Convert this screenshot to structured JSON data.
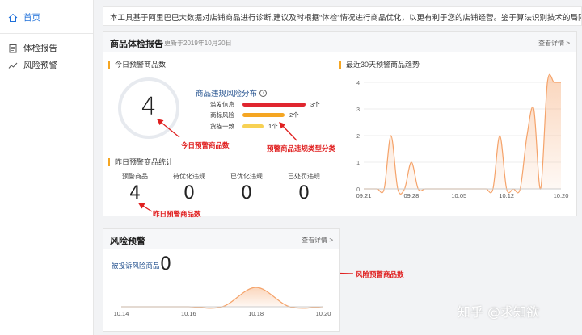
{
  "sidebar": {
    "items": [
      {
        "label": "首页",
        "icon": "home-icon",
        "active": true
      },
      {
        "label": "体检报告",
        "icon": "report-icon",
        "active": false
      },
      {
        "label": "风险预警",
        "icon": "trend-icon",
        "active": false
      }
    ]
  },
  "intro": "本工具基于阿里巴巴大数据对店铺商品进行诊断,建议及时根据“体检”情况进行商品优化，以更有利于您的店铺经营。鉴于算法识别技术的局限性、词汇语",
  "report": {
    "title": "商品体检报告",
    "updated": "更新于2019年10月20日",
    "more": "查看详情 >",
    "today": {
      "title": "今日预警商品数",
      "count": "4"
    },
    "dist": {
      "title": "商品违规风险分布",
      "rows": [
        {
          "label": "滥发信息",
          "count": "3个",
          "color": "#e0262f",
          "value": 3
        },
        {
          "label": "商标风险",
          "count": "2个",
          "color": "#f5a623",
          "value": 2
        },
        {
          "label": "货描一致",
          "count": "1个",
          "color": "#f7d154",
          "value": 1
        }
      ]
    },
    "yesterday": {
      "title": "昨日预警商品统计",
      "cols": [
        {
          "label": "预警商品",
          "value": "4"
        },
        {
          "label": "待优化违规",
          "value": "0"
        },
        {
          "label": "已优化违规",
          "value": "0"
        },
        {
          "label": "已处罚违规",
          "value": "0"
        }
      ]
    },
    "trend_title": "最近30天预警商品趋势"
  },
  "annotations": {
    "today": "今日预警商品数",
    "dist": "预警商品违规类型分类",
    "yesterday": "昨日预警商品数",
    "risk": "风险预警商品数"
  },
  "risk": {
    "title": "风险预警",
    "more": "查看详情 >",
    "label": "被投诉风险商品",
    "count": "0"
  },
  "watermark": "知乎 @求知欲",
  "chart_data": [
    {
      "type": "area",
      "title": "最近30天预警商品趋势",
      "x_ticks": [
        "09.21",
        "09.28",
        "10.05",
        "10.12",
        "10.20"
      ],
      "ylim": [
        0,
        4
      ],
      "y_ticks": [
        0,
        1,
        2,
        3,
        4
      ],
      "grid": true,
      "points": [
        {
          "x": "09.21",
          "y": 0
        },
        {
          "x": "09.22",
          "y": 0
        },
        {
          "x": "09.23",
          "y": 0
        },
        {
          "x": "09.24",
          "y": 0
        },
        {
          "x": "09.25",
          "y": 2
        },
        {
          "x": "09.26",
          "y": 0
        },
        {
          "x": "09.27",
          "y": 0
        },
        {
          "x": "09.28",
          "y": 1
        },
        {
          "x": "09.29",
          "y": 0
        },
        {
          "x": "09.30",
          "y": 0
        },
        {
          "x": "10.01",
          "y": 0
        },
        {
          "x": "10.02",
          "y": 0
        },
        {
          "x": "10.03",
          "y": 0
        },
        {
          "x": "10.04",
          "y": 0
        },
        {
          "x": "10.05",
          "y": 0
        },
        {
          "x": "10.06",
          "y": 0
        },
        {
          "x": "10.07",
          "y": 0
        },
        {
          "x": "10.08",
          "y": 0
        },
        {
          "x": "10.09",
          "y": 0
        },
        {
          "x": "10.10",
          "y": 0
        },
        {
          "x": "10.11",
          "y": 2
        },
        {
          "x": "10.12",
          "y": 0
        },
        {
          "x": "10.13",
          "y": 0
        },
        {
          "x": "10.14",
          "y": 0
        },
        {
          "x": "10.15",
          "y": 2
        },
        {
          "x": "10.16",
          "y": 3
        },
        {
          "x": "10.17",
          "y": 0
        },
        {
          "x": "10.18",
          "y": 4
        },
        {
          "x": "10.19",
          "y": 4
        },
        {
          "x": "10.20",
          "y": 4
        }
      ],
      "color": "#f5a36a"
    },
    {
      "type": "area",
      "x_ticks": [
        "10.14",
        "10.16",
        "10.18",
        "10.20"
      ],
      "points": [
        {
          "x": "10.14",
          "y": 0
        },
        {
          "x": "10.15",
          "y": 0
        },
        {
          "x": "10.16",
          "y": 0
        },
        {
          "x": "10.17",
          "y": 0
        },
        {
          "x": "10.18",
          "y": 1
        },
        {
          "x": "10.19",
          "y": 0
        },
        {
          "x": "10.20",
          "y": 0
        }
      ],
      "color": "#f5a36a"
    }
  ]
}
